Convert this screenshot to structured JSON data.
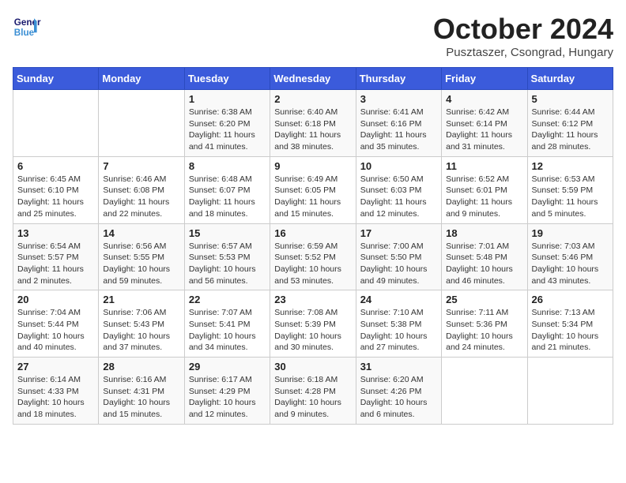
{
  "header": {
    "logo_line1": "General",
    "logo_line2": "Blue",
    "month": "October 2024",
    "location": "Pusztaszer, Csongrad, Hungary"
  },
  "weekdays": [
    "Sunday",
    "Monday",
    "Tuesday",
    "Wednesday",
    "Thursday",
    "Friday",
    "Saturday"
  ],
  "weeks": [
    [
      {
        "day": "",
        "content": ""
      },
      {
        "day": "",
        "content": ""
      },
      {
        "day": "1",
        "content": "Sunrise: 6:38 AM\nSunset: 6:20 PM\nDaylight: 11 hours and 41 minutes."
      },
      {
        "day": "2",
        "content": "Sunrise: 6:40 AM\nSunset: 6:18 PM\nDaylight: 11 hours and 38 minutes."
      },
      {
        "day": "3",
        "content": "Sunrise: 6:41 AM\nSunset: 6:16 PM\nDaylight: 11 hours and 35 minutes."
      },
      {
        "day": "4",
        "content": "Sunrise: 6:42 AM\nSunset: 6:14 PM\nDaylight: 11 hours and 31 minutes."
      },
      {
        "day": "5",
        "content": "Sunrise: 6:44 AM\nSunset: 6:12 PM\nDaylight: 11 hours and 28 minutes."
      }
    ],
    [
      {
        "day": "6",
        "content": "Sunrise: 6:45 AM\nSunset: 6:10 PM\nDaylight: 11 hours and 25 minutes."
      },
      {
        "day": "7",
        "content": "Sunrise: 6:46 AM\nSunset: 6:08 PM\nDaylight: 11 hours and 22 minutes."
      },
      {
        "day": "8",
        "content": "Sunrise: 6:48 AM\nSunset: 6:07 PM\nDaylight: 11 hours and 18 minutes."
      },
      {
        "day": "9",
        "content": "Sunrise: 6:49 AM\nSunset: 6:05 PM\nDaylight: 11 hours and 15 minutes."
      },
      {
        "day": "10",
        "content": "Sunrise: 6:50 AM\nSunset: 6:03 PM\nDaylight: 11 hours and 12 minutes."
      },
      {
        "day": "11",
        "content": "Sunrise: 6:52 AM\nSunset: 6:01 PM\nDaylight: 11 hours and 9 minutes."
      },
      {
        "day": "12",
        "content": "Sunrise: 6:53 AM\nSunset: 5:59 PM\nDaylight: 11 hours and 5 minutes."
      }
    ],
    [
      {
        "day": "13",
        "content": "Sunrise: 6:54 AM\nSunset: 5:57 PM\nDaylight: 11 hours and 2 minutes."
      },
      {
        "day": "14",
        "content": "Sunrise: 6:56 AM\nSunset: 5:55 PM\nDaylight: 10 hours and 59 minutes."
      },
      {
        "day": "15",
        "content": "Sunrise: 6:57 AM\nSunset: 5:53 PM\nDaylight: 10 hours and 56 minutes."
      },
      {
        "day": "16",
        "content": "Sunrise: 6:59 AM\nSunset: 5:52 PM\nDaylight: 10 hours and 53 minutes."
      },
      {
        "day": "17",
        "content": "Sunrise: 7:00 AM\nSunset: 5:50 PM\nDaylight: 10 hours and 49 minutes."
      },
      {
        "day": "18",
        "content": "Sunrise: 7:01 AM\nSunset: 5:48 PM\nDaylight: 10 hours and 46 minutes."
      },
      {
        "day": "19",
        "content": "Sunrise: 7:03 AM\nSunset: 5:46 PM\nDaylight: 10 hours and 43 minutes."
      }
    ],
    [
      {
        "day": "20",
        "content": "Sunrise: 7:04 AM\nSunset: 5:44 PM\nDaylight: 10 hours and 40 minutes."
      },
      {
        "day": "21",
        "content": "Sunrise: 7:06 AM\nSunset: 5:43 PM\nDaylight: 10 hours and 37 minutes."
      },
      {
        "day": "22",
        "content": "Sunrise: 7:07 AM\nSunset: 5:41 PM\nDaylight: 10 hours and 34 minutes."
      },
      {
        "day": "23",
        "content": "Sunrise: 7:08 AM\nSunset: 5:39 PM\nDaylight: 10 hours and 30 minutes."
      },
      {
        "day": "24",
        "content": "Sunrise: 7:10 AM\nSunset: 5:38 PM\nDaylight: 10 hours and 27 minutes."
      },
      {
        "day": "25",
        "content": "Sunrise: 7:11 AM\nSunset: 5:36 PM\nDaylight: 10 hours and 24 minutes."
      },
      {
        "day": "26",
        "content": "Sunrise: 7:13 AM\nSunset: 5:34 PM\nDaylight: 10 hours and 21 minutes."
      }
    ],
    [
      {
        "day": "27",
        "content": "Sunrise: 6:14 AM\nSunset: 4:33 PM\nDaylight: 10 hours and 18 minutes."
      },
      {
        "day": "28",
        "content": "Sunrise: 6:16 AM\nSunset: 4:31 PM\nDaylight: 10 hours and 15 minutes."
      },
      {
        "day": "29",
        "content": "Sunrise: 6:17 AM\nSunset: 4:29 PM\nDaylight: 10 hours and 12 minutes."
      },
      {
        "day": "30",
        "content": "Sunrise: 6:18 AM\nSunset: 4:28 PM\nDaylight: 10 hours and 9 minutes."
      },
      {
        "day": "31",
        "content": "Sunrise: 6:20 AM\nSunset: 4:26 PM\nDaylight: 10 hours and 6 minutes."
      },
      {
        "day": "",
        "content": ""
      },
      {
        "day": "",
        "content": ""
      }
    ]
  ]
}
